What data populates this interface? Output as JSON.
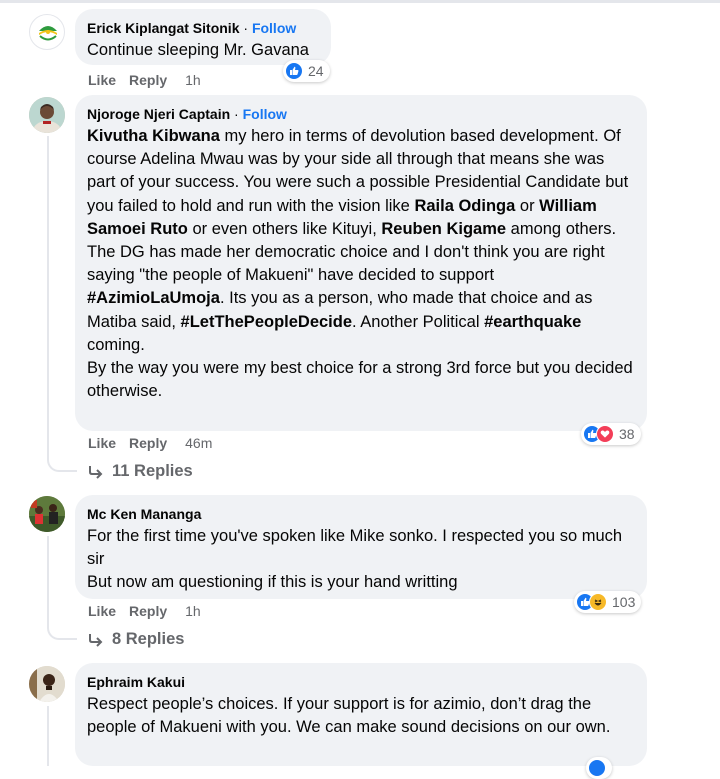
{
  "comments": [
    {
      "author": "Erick Kiplangat Sitonik",
      "follow": "Follow",
      "text": [
        "Continue sleeping Mr. Gavana"
      ],
      "like": "Like",
      "reply": "Reply",
      "time": "1h",
      "reaction_count": "24"
    },
    {
      "author": "Njoroge Njeri Captain",
      "follow": "Follow",
      "text_parts": {
        "p1a": "Kivutha Kibwana",
        "p1b": " my hero in terms of devolution based development. Of course Adelina Mwau was by your side all through that means she was part of your success. You were such a possible Presidential Candidate but you failed to hold and run with the vision like ",
        "p1c": "Raila Odinga",
        "p1d": " or ",
        "p1e": "William Samoei Ruto",
        "p1f": " or even others like Kituyi, ",
        "p1g": "Reuben Kigame",
        "p1h": " among others.",
        "p2a": "The DG has made her democratic choice and I don't think you are right saying \"the people of Makueni\" have decided to support ",
        "p2b": "#AzimioLaUmoja",
        "p2c": ". Its you as a person, who made that choice and as Matiba said, ",
        "p2d": "#LetThePeopleDecide",
        "p2e": ". Another Political ",
        "p2f": "#earthquake",
        "p2g": " coming.",
        "p3": "By the way you were my best choice for a strong 3rd force but you decided otherwise."
      },
      "like": "Like",
      "reply": "Reply",
      "time": "46m",
      "reaction_count": "38",
      "replies": "11 Replies"
    },
    {
      "author": "Mc Ken Mananga",
      "text": [
        "For the first time you've spoken like Mike sonko. I respected you so much sir",
        "But now am questioning if this is your hand writting"
      ],
      "like": "Like",
      "reply": "Reply",
      "time": "1h",
      "reaction_count": "103",
      "replies": "8 Replies"
    },
    {
      "author": "Ephraim Kakui",
      "text": [
        "Respect people’s choices. If your support is for azimio, don’t drag the people of Makueni with you. We can make sound decisions on our own."
      ]
    }
  ],
  "colors": {
    "bubble": "#f0f2f5",
    "link": "#1877f2",
    "muted": "#65676b",
    "like_blue": "#1877f2",
    "love_red": "#f33e58",
    "haha_yellow": "#f7b928"
  },
  "reaction_icons": [
    "like-icon",
    "love-icon",
    "haha-icon"
  ]
}
